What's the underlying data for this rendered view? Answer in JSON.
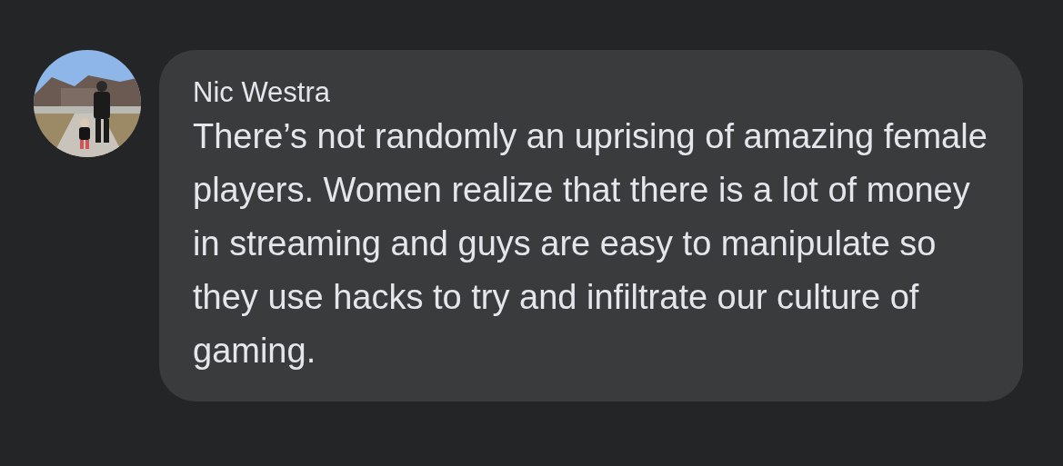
{
  "comment": {
    "author": "Nic Westra",
    "text": "There’s not randomly an uprising of amazing female players. Women realize that there is a lot of money in streaming and guys are easy to manipulate so they use hacks to try and infiltrate our culture of gaming."
  }
}
